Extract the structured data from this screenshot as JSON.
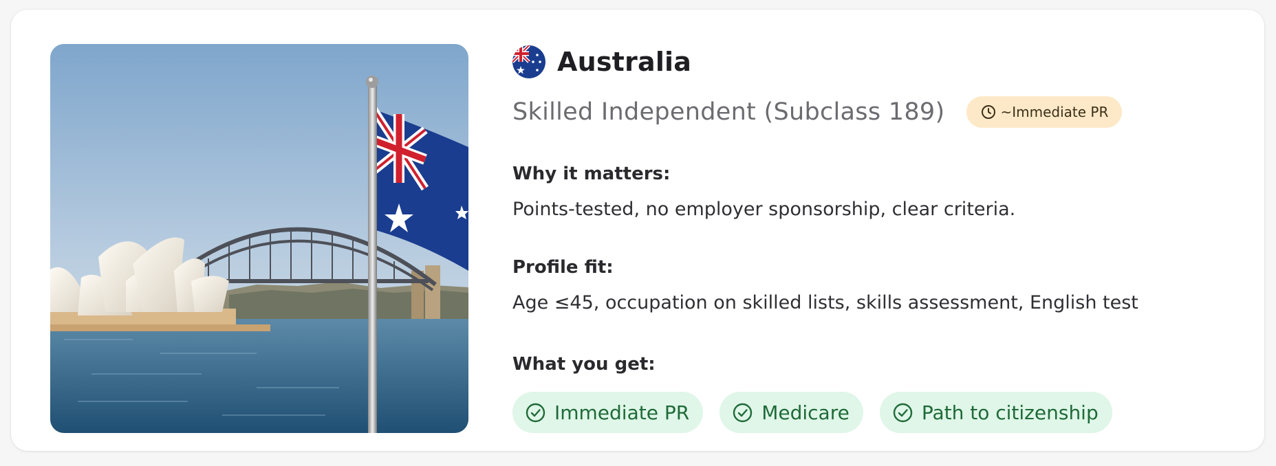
{
  "country": {
    "name": "Australia",
    "flag_icon": "australia-flag-icon"
  },
  "visa": {
    "name": "Skilled Independent (Subclass 189)",
    "timeline_badge": "~Immediate PR",
    "timeline_icon": "clock-icon"
  },
  "sections": {
    "why": {
      "label": "Why it matters:",
      "text": "Points-tested, no employer sponsorship, clear criteria."
    },
    "fit": {
      "label": "Profile fit:",
      "text": "Age ≤45, occupation on skilled lists, skills assessment, English test"
    },
    "get": {
      "label": "What you get:"
    }
  },
  "benefits": [
    {
      "label": "Immediate PR",
      "icon": "check-circle-icon"
    },
    {
      "label": "Medicare",
      "icon": "check-circle-icon"
    },
    {
      "label": "Path to citizenship",
      "icon": "check-circle-icon"
    }
  ],
  "photo": {
    "subject": "sydney-harbour-photo"
  },
  "colors": {
    "badge_bg": "#fde9c8",
    "benefit_bg": "#dff6e8",
    "benefit_text": "#1f6a38",
    "flag_blue": "#1a3d8f",
    "flag_red": "#d0202e"
  }
}
